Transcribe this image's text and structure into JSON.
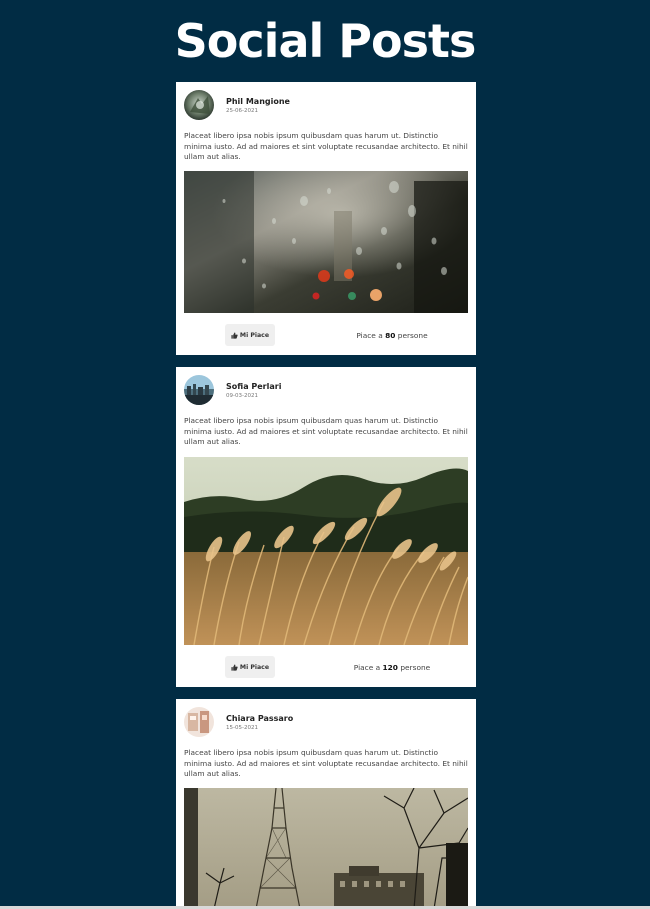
{
  "page": {
    "title": "Social Posts"
  },
  "colors": {
    "background": "#012c44",
    "card": "#ffffff",
    "button": "#efefef"
  },
  "posts": [
    {
      "author": "Phil Mangione",
      "date": "25-06-2021",
      "text": "Placeat libero ipsa nobis ipsum quibusdam quas harum ut. Distinctio minima iusto. Ad ad maiores et sint voluptate recusandae architecto. Et nihil ullam aut alias.",
      "like_label": "Mi Piace",
      "likes_prefix": "Piace a",
      "likes_count": "80",
      "likes_suffix": "persone",
      "image": "rainy-window-city-lights"
    },
    {
      "author": "Sofia Perlari",
      "date": "09-03-2021",
      "text": "Placeat libero ipsa nobis ipsum quibusdam quas harum ut. Distinctio minima iusto. Ad ad maiores et sint voluptate recusandae architecto. Et nihil ullam aut alias.",
      "like_label": "Mi Piace",
      "likes_prefix": "Piace a",
      "likes_count": "120",
      "likes_suffix": "persone",
      "image": "wheat-field"
    },
    {
      "author": "Chiara Passaro",
      "date": "15-05-2021",
      "text": "Placeat libero ipsa nobis ipsum quibusdam quas harum ut. Distinctio minima iusto. Ad ad maiores et sint voluptate recusandae architecto. Et nihil ullam aut alias.",
      "image": "eiffel-tower"
    }
  ]
}
